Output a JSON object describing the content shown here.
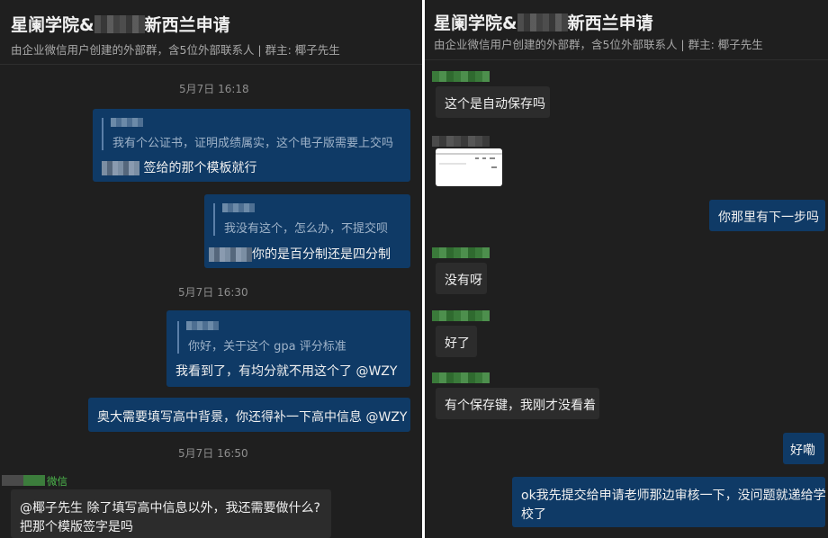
{
  "left": {
    "title_pre": "星阑学院&",
    "title_post": "新西兰申请",
    "subtitle": "由企业微信用户创建的外部群，含5位外部联系人 | 群主: 椰子先生",
    "time1": "5月7日 16:18",
    "msg1_quote": "我有个公证书，证明成绩属实，这个电子版需要上交吗",
    "msg1_text": "签给的那个模板就行",
    "msg2_quote": "我没有这个，怎么办，不提交呗",
    "msg2_text": "你的是百分制还是四分制",
    "time2": "5月7日 16:30",
    "msg3_quote": "你好，关于这个 gpa 评分标准",
    "msg3_text": "我看到了，有均分就不用这个了 @WZY",
    "msg4_text": "奥大需要填写高中背景，你还得补一下高中信息 @WZY",
    "time3": "5月7日 16:50",
    "sender_tag": "微信",
    "msg5_line1": "@椰子先生 除了填写高中信息以外，我还需要做什么?",
    "msg5_line2": "把那个模版签字是吗"
  },
  "right": {
    "title_pre": "星阑学院&",
    "title_post": "新西兰申请",
    "subtitle": "由企业微信用户创建的外部群，含5位外部联系人 | 群主: 椰子先生",
    "msg1": "这个是自动保存吗",
    "msg2": "你那里有下一步吗",
    "msg3": "没有呀",
    "msg4": "好了",
    "msg5": "有个保存键，我刚才没看着",
    "msg6": "好嘞",
    "msg7_line1": "ok我先提交给申请老师那边审核一下，没问题就递给学",
    "msg7_line2": "校了"
  },
  "colors": {
    "panel_bg": "#1f1f1f",
    "outgoing_bubble": "#0f3a66",
    "incoming_bubble": "#2c2c2c",
    "wechat_green": "#4cb84c"
  }
}
